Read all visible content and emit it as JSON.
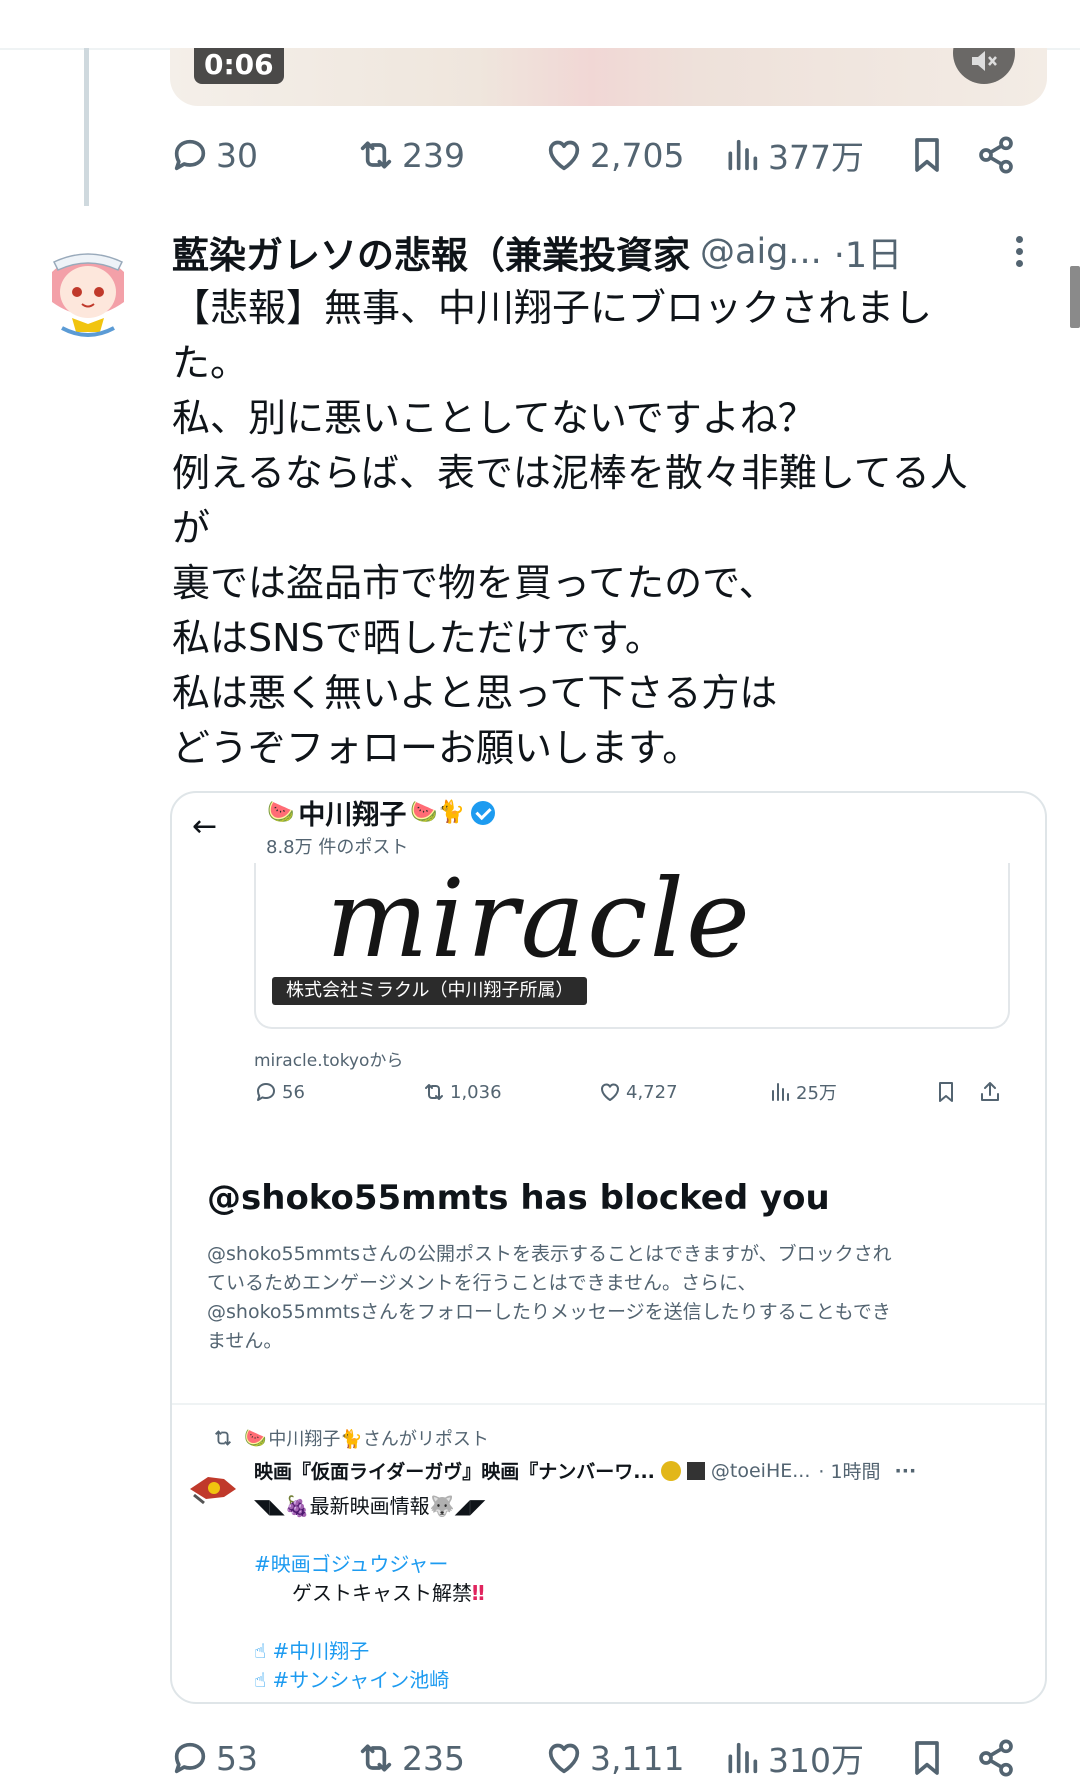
{
  "video": {
    "time": "0:06"
  },
  "prev_actions": {
    "replies": "30",
    "reposts": "239",
    "likes": "2,705",
    "views": "377万"
  },
  "tweet": {
    "name": "藍染ガレソの悲報（兼業投資家",
    "handle": "@aig...",
    "time": "·1日",
    "lines": [
      "【悲報】無事、中川翔子にブロックされまし",
      "た。",
      "私、別に悪いことしてないですよね？",
      "例えるならば、表では泥棒を散々非難してる人",
      "が",
      "裏では盗品市で物を買ってたので、",
      "私はSNSで晒しただけです。",
      "私は悪く無いよと思って下さる方は",
      "どうぞフォローお願いします。"
    ]
  },
  "embed": {
    "back": "←",
    "profile_name": "中川翔子",
    "profile_subtitle": "8.8万 件のポスト",
    "banner_logo": "miracle",
    "banner_label": "株式会社ミラクル（中川翔子所属）",
    "source": "miracle.tokyoから",
    "actions": {
      "replies": "56",
      "reposts": "1,036",
      "likes": "4,727",
      "views": "25万"
    },
    "blocked_title": "@shoko55mmts has blocked you",
    "blocked_desc": [
      "@shoko55mmtsさんの公開ポストを表示することはできますが、ブロックされ",
      "ているためエンゲージメントを行うことはできません。さらに、",
      "@shoko55mmtsさんをフォローしたりメッセージを送信したりすることもでき",
      "ません。"
    ],
    "repost_label": "中川翔子🐈さんがリポスト",
    "rp_name": "映画『仮面ライダーガヴ』映画『ナンバーワ...",
    "rp_handle": "@toeiHE...",
    "rp_time": "· 1時間",
    "rp_more": "···",
    "rp_line1": "◥◣🍇最新映画情報🐺◢◤",
    "rp_tag1": "#映画ゴジュウジャー",
    "rp_line2": "ゲストキャスト解禁",
    "rp_exclaim": "‼",
    "rp_tag2": "☝ #中川翔子",
    "rp_tag3": "☝ #サンシャイン池崎"
  },
  "actions": {
    "replies": "53",
    "reposts": "235",
    "likes": "3,111",
    "views": "310万"
  },
  "colors": {
    "text": "#0f1419",
    "muted": "#536471",
    "accent": "#1d9bf0",
    "border": "#eff3f4"
  }
}
